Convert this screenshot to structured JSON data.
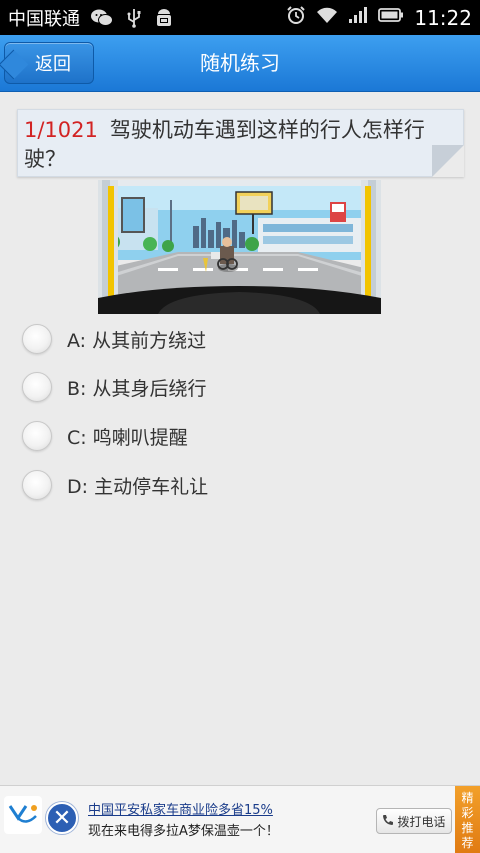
{
  "status_bar": {
    "carrier": "中国联通",
    "time": "11:22",
    "icons": [
      "wechat-icon",
      "usb-icon",
      "android-debug-icon",
      "alarm-icon",
      "wifi-icon",
      "signal-icon",
      "battery-icon"
    ]
  },
  "header": {
    "back_label": "返回",
    "title": "随机练习"
  },
  "question": {
    "number": "1/1021",
    "text": "驾驶机动车遇到这样的行人怎样行驶？"
  },
  "options": [
    {
      "label": "A: 从其前方绕过"
    },
    {
      "label": "B: 从其身后绕行"
    },
    {
      "label": "C: 鸣喇叭提醒"
    },
    {
      "label": "D: 主动停车礼让"
    }
  ],
  "ad": {
    "line1": "中国平安私家车商业险多省15%",
    "line2": "现在来电得多拉A梦保温壶一个！",
    "call_label": "拨打电话",
    "badge": [
      "精",
      "彩",
      "推",
      "荐"
    ]
  },
  "colors": {
    "header_blue": "#1b78d6",
    "question_number_red": "#d22323",
    "badge_orange": "#e8891a"
  }
}
